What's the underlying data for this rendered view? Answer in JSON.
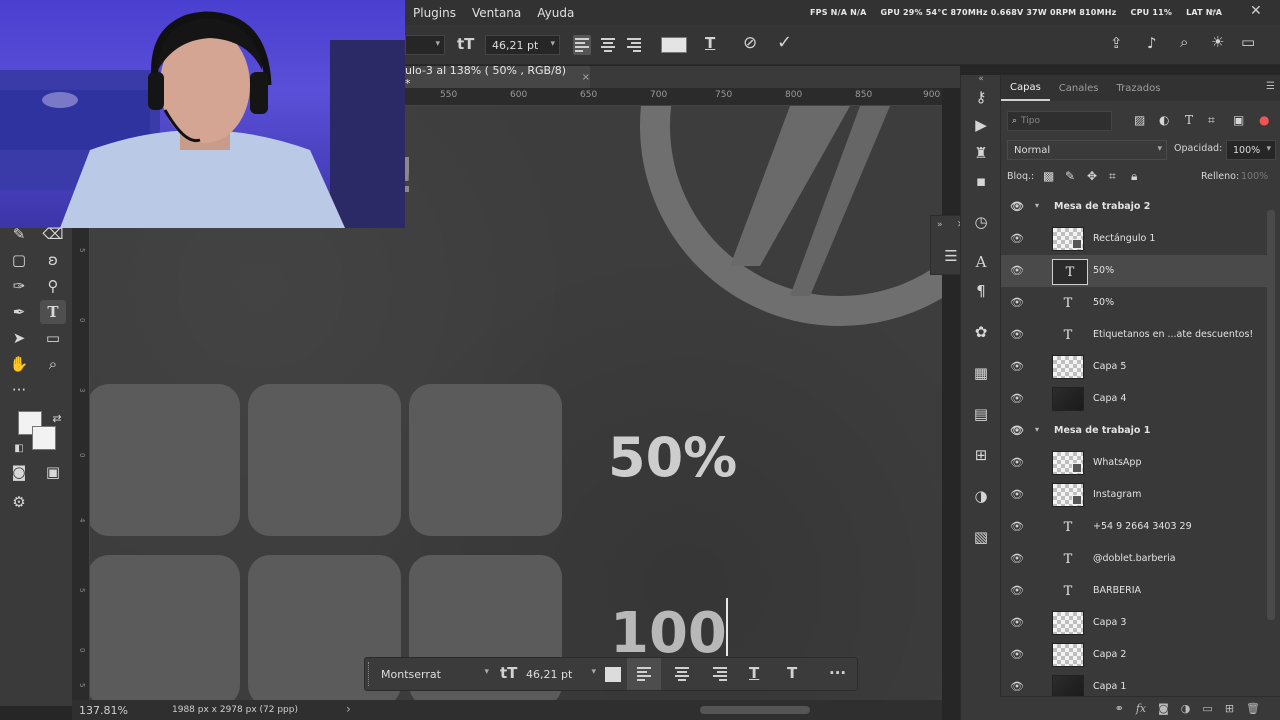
{
  "menubar": {
    "items": [
      "Plugins",
      "Ventana",
      "Ayuda"
    ],
    "stats": {
      "fps": "FPS N/A N/A",
      "gpu": "GPU 29% 54°C 870MHz 0.668V 37W 0RPM 810MHz",
      "cpu": "CPU 11%",
      "lat": "LAT N/A"
    }
  },
  "options_bar": {
    "font_size": "46,21 pt",
    "font_size_icon": "tT",
    "warp_icon": "T",
    "cancel_icon": "⊘",
    "commit_icon": "✓"
  },
  "document": {
    "tab_title": "ulo-3 al 138% ( 50% , RGB/8) *",
    "close": "×"
  },
  "ruler": {
    "h_ticks": [
      "550",
      "600",
      "650",
      "700",
      "750",
      "800",
      "850",
      "900"
    ],
    "v_ticks": [
      "5",
      "0",
      "3",
      "0",
      "4",
      "5",
      "0",
      "5"
    ]
  },
  "canvas": {
    "fragment_text": "s!",
    "big_text_1": "50%",
    "big_text_2": "100"
  },
  "floating_bar": {
    "font": "Montserrat",
    "size": "46,21 pt",
    "size_icon": "tT",
    "more": "···"
  },
  "statusbar": {
    "zoom": "137.81%",
    "dims": "1988 px x 2978 px (72 ppp)",
    "arrow": "›"
  },
  "layers_panel": {
    "tabs": [
      "Capas",
      "Canales",
      "Trazados"
    ],
    "search_placeholder": "Tipo",
    "blend_mode": "Normal",
    "opacity_label": "Opacidad:",
    "opacity_value": "100%",
    "lock_label": "Bloq.:",
    "fill_label": "Relleno:",
    "fill_value": "100%",
    "rows": [
      {
        "name": "Mesa de trabajo 2",
        "kind": "group"
      },
      {
        "name": "Rectángulo 1",
        "kind": "smart"
      },
      {
        "name": "50%",
        "kind": "text-selected"
      },
      {
        "name": "50%",
        "kind": "text"
      },
      {
        "name": "Etiquetanos en ...ate descuentos!",
        "kind": "text"
      },
      {
        "name": "Capa 5",
        "kind": "check"
      },
      {
        "name": "Capa 4",
        "kind": "dark"
      },
      {
        "name": "Mesa de trabajo 1",
        "kind": "group"
      },
      {
        "name": "WhatsApp",
        "kind": "smart"
      },
      {
        "name": "Instagram",
        "kind": "smart"
      },
      {
        "name": "+54 9 2664 3403 29",
        "kind": "text"
      },
      {
        "name": "@doblet.barberia",
        "kind": "text"
      },
      {
        "name": "BARBERIA",
        "kind": "text"
      },
      {
        "name": "Capa 3",
        "kind": "check"
      },
      {
        "name": "Capa 2",
        "kind": "check"
      },
      {
        "name": "Capa 1",
        "kind": "dark"
      }
    ]
  },
  "colors": {
    "panel_bg": "#393939",
    "canvas_bg": "#3d3d3d",
    "webcam_bg": "#5a4fd8",
    "text_highlight": "#cdcdcd"
  }
}
